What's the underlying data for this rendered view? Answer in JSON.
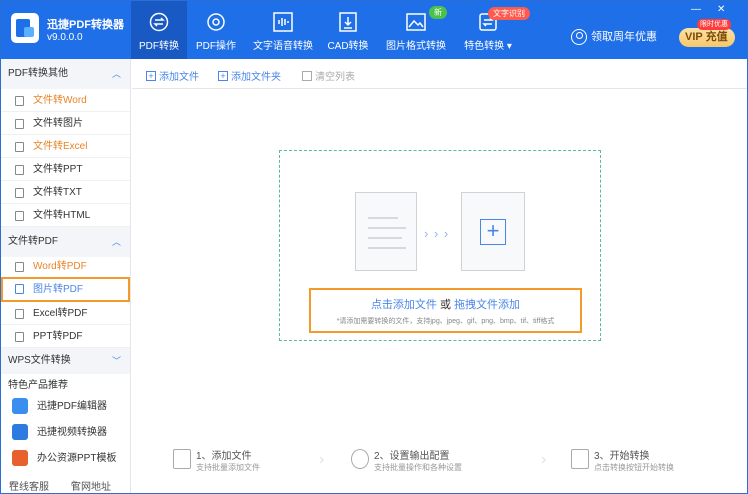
{
  "app": {
    "name": "迅捷PDF转换器",
    "version": "v9.0.0.0"
  },
  "tabs": [
    {
      "label": "PDF转换",
      "icon": "convert-icon",
      "active": true
    },
    {
      "label": "PDF操作",
      "icon": "settings-gear-icon",
      "active": false
    },
    {
      "label": "文字语音转换",
      "icon": "audio-wave-icon",
      "active": false
    },
    {
      "label": "CAD转换",
      "icon": "cad-download-icon",
      "active": false
    },
    {
      "label": "图片格式转换",
      "icon": "image-icon",
      "active": false
    },
    {
      "label": "特色转换",
      "icon": "feature-convert-icon",
      "active": false
    }
  ],
  "badges": {
    "new": "新",
    "ocr": "文字识别"
  },
  "window": {
    "minimize": "—",
    "close": "✕"
  },
  "header_right": {
    "anniversary": "领取周年优惠",
    "vip_tag": "限时优惠",
    "vip_label": "VIP 充值"
  },
  "sidebar": {
    "sections": [
      {
        "title": "PDF转换其他",
        "chevron": "︿",
        "items": [
          "文件转Word",
          "文件转图片",
          "文件转Excel",
          "文件转PPT",
          "文件转TXT",
          "文件转HTML"
        ]
      },
      {
        "title": "文件转PDF",
        "chevron": "︿",
        "items": [
          "Word转PDF",
          "图片转PDF",
          "Excel转PDF",
          "PPT转PDF"
        ]
      },
      {
        "title": "WPS文件转换",
        "chevron": "﹀",
        "items": []
      }
    ],
    "promo_title": "特色产品推荐",
    "promos": [
      "迅捷PDF编辑器",
      "迅捷视频转换器",
      "办公资源PPT模板"
    ],
    "footer": {
      "support": "在线客服",
      "website": "官网地址"
    }
  },
  "toolbar": {
    "add_file": "添加文件",
    "add_folder": "添加文件夹",
    "clear_list": "清空列表"
  },
  "dropzone": {
    "click_add": "点击添加文件",
    "or": " 或 ",
    "drag_add": "拖拽文件添加",
    "formats_hint": "*请添加需要转换的文件，支持jpg、jpeg、gif、png、bmp、tif、tiff格式",
    "arrows": "› › ›",
    "plus": "+"
  },
  "steps": [
    {
      "title": "1、添加文件",
      "desc": "支持批量添加文件"
    },
    {
      "title": "2、设置输出配置",
      "desc": "支持批量操作和各种设置"
    },
    {
      "title": "3、开始转换",
      "desc": "点击转换按钮开始转换"
    }
  ],
  "colors": {
    "brand": "#1e6fe8",
    "highlight": "#f39a2b",
    "link": "#4a86e8"
  }
}
